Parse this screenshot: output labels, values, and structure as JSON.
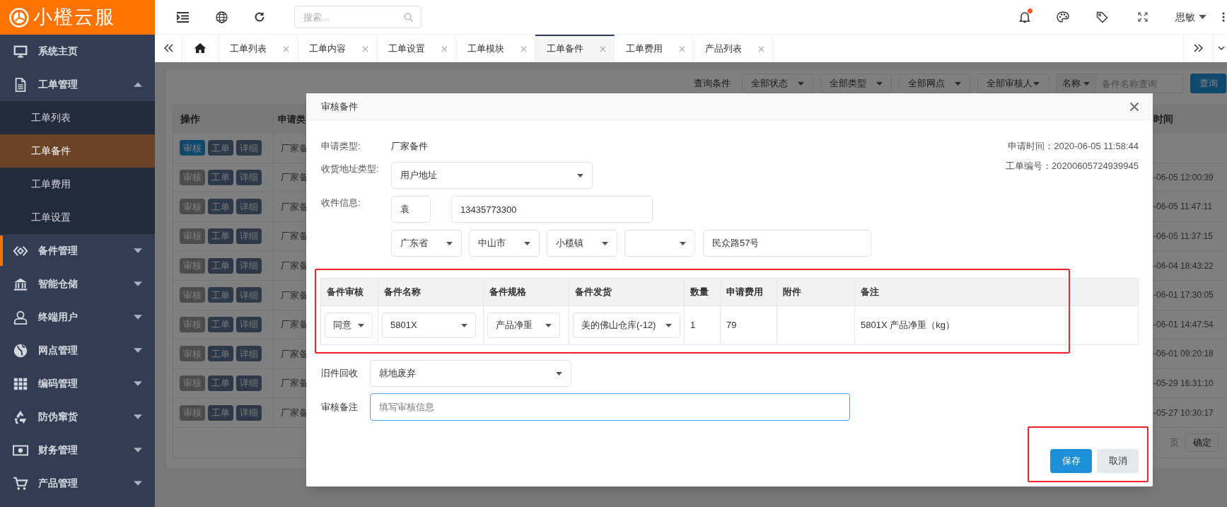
{
  "header": {
    "logo_text": "小橙云服",
    "search": {
      "placeholder": "搜索..."
    },
    "notification": true,
    "user": "思敏"
  },
  "tabs": [
    {
      "label": "工单列表",
      "selected": false
    },
    {
      "label": "工单内容",
      "selected": false
    },
    {
      "label": "工单设置",
      "selected": false
    },
    {
      "label": "工单模块",
      "selected": false
    },
    {
      "label": "工单备件",
      "selected": true
    },
    {
      "label": "工单费用",
      "selected": false
    },
    {
      "label": "产品列表",
      "selected": false
    }
  ],
  "sidebar": {
    "items": [
      {
        "label": "系统主页",
        "hovered": false
      },
      {
        "label": "工单管理",
        "hovered": false,
        "expanded": true,
        "children": [
          {
            "label": "工单列表",
            "selected": false
          },
          {
            "label": "工单备件",
            "selected": true
          },
          {
            "label": "工单费用",
            "selected": false
          },
          {
            "label": "工单设置",
            "selected": false
          }
        ]
      },
      {
        "label": "备件管理",
        "hovered": true,
        "expanded": false
      },
      {
        "label": "智能仓储",
        "hovered": false,
        "expanded": false
      },
      {
        "label": "终端用户",
        "hovered": false,
        "expanded": false
      },
      {
        "label": "网点管理",
        "hovered": false,
        "expanded": false
      },
      {
        "label": "编码管理",
        "hovered": false,
        "expanded": false
      },
      {
        "label": "防伪窜货",
        "hovered": false,
        "expanded": false
      },
      {
        "label": "财务管理",
        "hovered": false,
        "expanded": false
      },
      {
        "label": "产品管理",
        "hovered": false,
        "expanded": false
      }
    ]
  },
  "filters": {
    "label": "查询条件",
    "selects": [
      "全部状态",
      "全部类型",
      "全部网点",
      "全部审核人"
    ],
    "search_scope": "名称",
    "search_placeholder": "备件名称查询",
    "button": "查询"
  },
  "table": {
    "columns": [
      "操作",
      "申请类",
      "时间"
    ],
    "rows": [
      {
        "actions": [
          "审核",
          "工单",
          "详细"
        ],
        "audit_enabled": true,
        "type": "厂家备"
      },
      {
        "actions": [
          "审核",
          "工单",
          "详细"
        ],
        "audit_enabled": false,
        "type": "厂家备",
        "time": "-06-05 12:00:39"
      },
      {
        "actions": [
          "审核",
          "工单",
          "详细"
        ],
        "audit_enabled": false,
        "type": "厂家备",
        "time": "-06-05 11:47:11"
      },
      {
        "actions": [
          "审核",
          "工单",
          "详细"
        ],
        "audit_enabled": false,
        "type": "厂家备",
        "time": "-06-05 11:37:15"
      },
      {
        "actions": [
          "审核",
          "工单",
          "详细"
        ],
        "audit_enabled": false,
        "type": "厂家备",
        "time": "-06-04 18:43:22"
      },
      {
        "actions": [
          "审核",
          "工单",
          "详细"
        ],
        "audit_enabled": false,
        "type": "厂家备",
        "time": "-06-01 17:30:05"
      },
      {
        "actions": [
          "审核",
          "工单",
          "详细"
        ],
        "audit_enabled": false,
        "type": "厂家备",
        "time": "-06-01 14:47:54"
      },
      {
        "actions": [
          "审核",
          "工单",
          "详细"
        ],
        "audit_enabled": false,
        "type": "厂家备",
        "time": "-06-01 09:20:18"
      },
      {
        "actions": [
          "审核",
          "工单",
          "详细"
        ],
        "audit_enabled": false,
        "type": "厂家备",
        "time": "-05-29 16:31:10"
      },
      {
        "actions": [
          "审核",
          "工单",
          "详细"
        ],
        "audit_enabled": false,
        "type": "厂家备",
        "time": "-05-27 10:30:17"
      }
    ],
    "pager": {
      "page_suffix": "页",
      "confirm": "确定"
    }
  },
  "modal": {
    "title": "审核备件",
    "apply_type": {
      "label": "申请类型:",
      "value": "厂家备件"
    },
    "apply_time": "申请时间：2020-06-05 11:58:44",
    "order_no": "工单编号：20200605724939945",
    "address_type": {
      "label": "收货地址类型:",
      "value": "用户地址"
    },
    "recipient": {
      "label": "收件信息:",
      "name": "袁",
      "phone": "13435773300",
      "province": "广东省",
      "city": "中山市",
      "town": "小榄镇",
      "street": "民众路57号"
    },
    "parts_table": {
      "columns": [
        "备件审核",
        "备件名称",
        "备件规格",
        "备件发货",
        "数量",
        "申请费用",
        "附件",
        "备注"
      ],
      "rows": [
        {
          "audit": "同意",
          "name": "5801X",
          "spec": "产品净重",
          "warehouse": "美的佛山仓库(-12)",
          "qty": "1",
          "fee": "79",
          "remark": "5801X 产品净重（kg）"
        }
      ]
    },
    "old_parts": {
      "label": "旧件回收",
      "value": "就地废弃"
    },
    "audit_remark": {
      "label": "审核备注",
      "placeholder": "填写审核信息",
      "focused": true
    },
    "buttons": [
      {
        "label": "保存",
        "kind": "primary"
      },
      {
        "label": "取消",
        "kind": "secondary"
      }
    ]
  }
}
